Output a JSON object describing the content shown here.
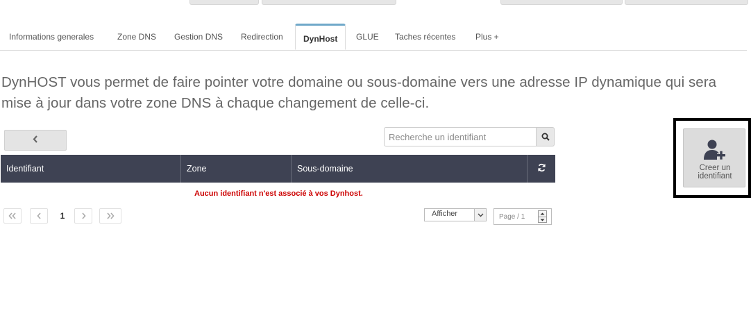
{
  "tabs": [
    {
      "label": "Informations generales"
    },
    {
      "label": "Zone DNS"
    },
    {
      "label": "Gestion DNS"
    },
    {
      "label": "Redirection"
    },
    {
      "label": "DynHost"
    },
    {
      "label": "GLUE"
    },
    {
      "label": "Taches récentes"
    },
    {
      "label": "Plus +"
    }
  ],
  "active_tab": "DynHost",
  "intro": "DynHOST vous permet de faire pointer votre domaine ou sous-domaine vers une adresse IP dynamique qui sera mise à jour dans votre zone DNS à chaque changement de celle-ci.",
  "search": {
    "placeholder": "Recherche un identifiant"
  },
  "table": {
    "columns": [
      "Identifiant",
      "Zone",
      "Sous-domaine"
    ],
    "empty_message": "Aucun identifiant n'est associé à vos Dynhost."
  },
  "pagination": {
    "current_page": "1",
    "show_label": "Afficher",
    "page_placeholder": "Page  / 1"
  },
  "create_button": {
    "label": "Creer un identifiant"
  },
  "colors": {
    "table_header": "#3e4253",
    "active_tab_accent": "#6fa8c9",
    "error_text": "#cc0000"
  },
  "icons": [
    "chevron-left-icon",
    "search-icon",
    "refresh-icon",
    "double-chevron-left-icon",
    "double-chevron-right-icon",
    "chevron-right-icon",
    "user-plus-icon"
  ]
}
